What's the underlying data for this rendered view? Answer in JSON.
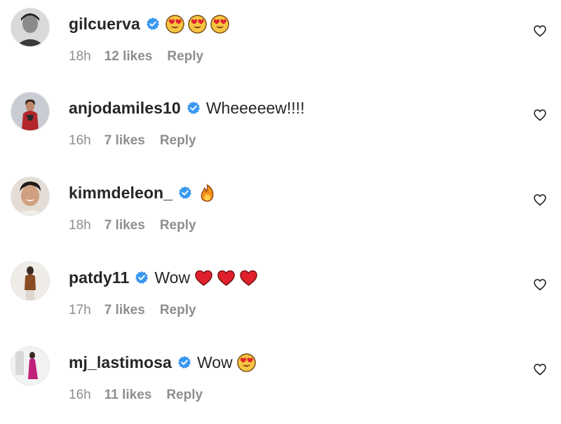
{
  "comments": [
    {
      "username": "gilcuerva",
      "text": "",
      "emojis": [
        "heart-eyes",
        "heart-eyes",
        "heart-eyes"
      ],
      "time": "18h",
      "likes": "12 likes",
      "reply": "Reply",
      "verified": true
    },
    {
      "username": "anjodamiles10",
      "text": "Wheeeeew!!!!",
      "emojis": [],
      "time": "16h",
      "likes": "7 likes",
      "reply": "Reply",
      "verified": true
    },
    {
      "username": "kimmdeleon_",
      "text": "",
      "emojis": [
        "fire"
      ],
      "time": "18h",
      "likes": "7 likes",
      "reply": "Reply",
      "verified": true
    },
    {
      "username": "patdy11",
      "text": "Wow",
      "emojis": [
        "red-heart",
        "red-heart",
        "red-heart"
      ],
      "time": "17h",
      "likes": "7 likes",
      "reply": "Reply",
      "verified": true
    },
    {
      "username": "mj_lastimosa",
      "text": "Wow",
      "emojis": [
        "heart-eyes"
      ],
      "time": "16h",
      "likes": "11 likes",
      "reply": "Reply",
      "verified": true
    }
  ],
  "colors": {
    "verified": "#3897f0",
    "meta": "#8e8e8e",
    "text": "#262626"
  }
}
